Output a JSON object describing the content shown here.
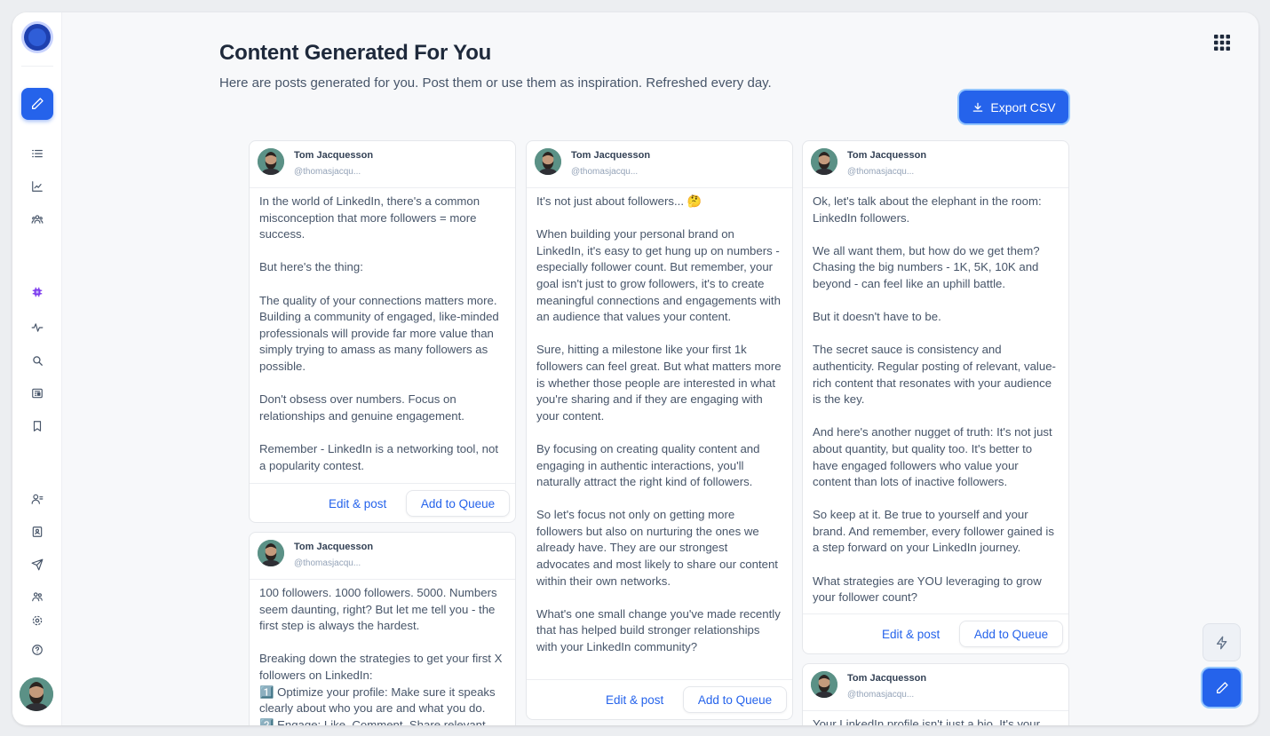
{
  "header": {
    "title": "Content Generated For You",
    "subtitle": "Here are posts generated for you. Post them or use them as inspiration. Refreshed every day.",
    "export_label": "Export CSV"
  },
  "sidebar": {
    "icons": [
      "logo",
      "pencil-icon",
      "list-icon",
      "line-chart-icon",
      "users-icon",
      "chip-icon",
      "activity-icon",
      "search-icon",
      "newspaper-icon",
      "bookmark-icon",
      "user-list-icon",
      "contact-card-icon",
      "send-icon",
      "team-icon",
      "settings-icon",
      "help-icon",
      "avatar"
    ]
  },
  "actions": {
    "edit_label": "Edit & post",
    "queue_label": "Add to Queue"
  },
  "colors": {
    "accent": "#2563eb",
    "text": "#475569",
    "title": "#1e293b"
  },
  "posts": [
    {
      "author": "Tom Jacquesson",
      "handle": "@thomasjacqu...",
      "text": "In the world of LinkedIn, there's a common misconception that more followers = more success.\n\nBut here's the thing:\n\nThe quality of your connections matters more. Building a community of engaged, like-minded professionals will provide far more value than simply trying to amass as many followers as possible.\n\nDon't obsess over numbers. Focus on relationships and genuine engagement.\n\nRemember - LinkedIn is a networking tool, not a popularity contest."
    },
    {
      "author": "Tom Jacquesson",
      "handle": "@thomasjacqu...",
      "text": "100 followers. 1000 followers. 5000. Numbers seem daunting, right? But let me tell you - the first step is always the hardest.\n\nBreaking down the strategies to get your first X followers on LinkedIn:\n1️⃣ Optimize your profile: Make sure it speaks clearly about who you are and what you do.\n2️⃣ Engage: Like, Comment, Share relevant"
    },
    {
      "author": "Tom Jacquesson",
      "handle": "@thomasjacqu...",
      "text": "It's not just about followers... 🤔\n\nWhen building your personal brand on LinkedIn, it's easy to get hung up on numbers - especially follower count. But remember, your goal isn't just to grow followers, it's to create meaningful connections and engagements with an audience that values your content.\n\nSure, hitting a milestone like your first 1k followers can feel great. But what matters more is whether those people are interested in what you're sharing and if they are engaging with your content.\n\nBy focusing on creating quality content and engaging in authentic interactions, you'll naturally attract the right kind of followers.\n\nSo let's focus not only on getting more followers but also on nurturing the ones we already have. They are our strongest advocates and most likely to share our content within their own networks.\n\nWhat's one small change you've made recently that has helped build stronger relationships with your LinkedIn community?"
    },
    {
      "author": "Tom Jacquesson",
      "handle": "@thomasjacqu...",
      "text": "Ok, let's talk about the elephant in the room: LinkedIn followers.\n\nWe all want them, but how do we get them? Chasing the big numbers - 1K, 5K, 10K and beyond - can feel like an uphill battle.\n\nBut it doesn't have to be.\n\nThe secret sauce is consistency and authenticity. Regular posting of relevant, value-rich content that resonates with your audience is the key.\n\nAnd here's another nugget of truth: It's not just about quantity, but quality too. It's better to have engaged followers who value your content than lots of inactive followers.\n\nSo keep at it. Be true to yourself and your brand. And remember, every follower gained is a step forward on your LinkedIn journey.\n\nWhat strategies are YOU leveraging to grow your follower count?"
    },
    {
      "author": "Tom Jacquesson",
      "handle": "@thomasjacqu...",
      "text": "Your LinkedIn profile isn't just a bio. It's your"
    }
  ]
}
